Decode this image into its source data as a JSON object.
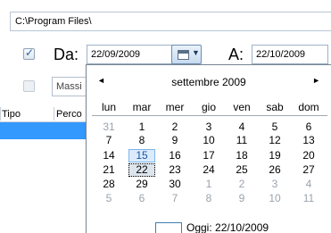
{
  "path": "C:\\Program Files\\",
  "date_from": {
    "checked": true,
    "label": "Da:",
    "value": "22/09/2009"
  },
  "date_to": {
    "label": "A:",
    "value": "22/10/2009"
  },
  "filter": {
    "checked": false,
    "value": "Massi"
  },
  "grid": {
    "columns": [
      "Tipo",
      "Perco"
    ]
  },
  "calendar": {
    "month_title": "settembre 2009",
    "prev_glyph": "◄",
    "next_glyph": "►",
    "weekdays": [
      "lun",
      "mar",
      "mer",
      "gio",
      "ven",
      "sab",
      "dom"
    ],
    "weeks": [
      [
        "31",
        "1",
        "2",
        "3",
        "4",
        "5",
        "6"
      ],
      [
        "7",
        "8",
        "9",
        "10",
        "11",
        "12",
        "13"
      ],
      [
        "14",
        "15",
        "16",
        "17",
        "18",
        "19",
        "20"
      ],
      [
        "21",
        "22",
        "23",
        "24",
        "25",
        "26",
        "27"
      ],
      [
        "28",
        "29",
        "30",
        "1",
        "2",
        "3",
        "4"
      ],
      [
        "5",
        "6",
        "7",
        "8",
        "9",
        "10",
        "11"
      ]
    ],
    "today_label": "Oggi: 22/10/2009"
  },
  "colors": {
    "selection_row": "#3399ff",
    "today_box_border": "#3c7fb1",
    "out_of_month_text": "#9aa3ad"
  }
}
